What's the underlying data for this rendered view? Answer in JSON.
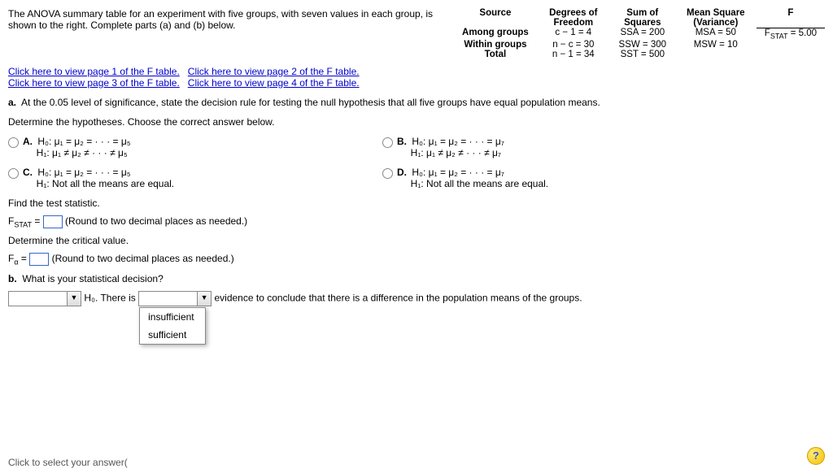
{
  "intro": "The ANOVA summary table for an experiment with five groups, with seven values in each group, is shown to the right. Complete parts (a) and (b) below.",
  "anova": {
    "headers": {
      "source": "Source",
      "df": "Degrees of Freedom",
      "ss": "Sum of Squares",
      "ms": "Mean Square (Variance)",
      "f": "F"
    },
    "rows": {
      "among": {
        "label": "Among groups",
        "df": "c − 1 = 4",
        "ss": "SSA = 200",
        "ms": "MSA = 50",
        "f_label": "F",
        "f_sub": "STAT",
        "f_val": " = 5.00"
      },
      "within": {
        "label": "Within groups",
        "df": "n − c = 30",
        "ss": "SSW = 300",
        "ms": "MSW = 10"
      },
      "total": {
        "label": "Total",
        "df": "n − 1 = 34",
        "ss": "SST = 500"
      }
    }
  },
  "links": {
    "p1": "Click here to view page 1 of the F table.",
    "p2": "Click here to view page 2 of the F table.",
    "p3": "Click here to view page 3 of the F table.",
    "p4": "Click here to view page 4 of the F table."
  },
  "qa": {
    "prompt_label": "a.",
    "prompt": "At the 0.05 level of significance, state the decision rule for testing the null hypothesis that all five groups have equal population means.",
    "determine": "Determine the hypotheses. Choose the correct answer below."
  },
  "options": {
    "a": {
      "lbl": "A.",
      "l1": "H₀: μ₁ = μ₂ = · · · = μ₅",
      "l2": "H₁: μ₁ ≠ μ₂ ≠ · · · ≠ μ₅"
    },
    "b": {
      "lbl": "B.",
      "l1": "H₀: μ₁ = μ₂ = · · · = μ₇",
      "l2": "H₁: μ₁ ≠ μ₂ ≠ · · · ≠ μ₇"
    },
    "c": {
      "lbl": "C.",
      "l1": "H₀: μ₁ = μ₂ = · · · = μ₅",
      "l2": "H₁: Not all the means are equal."
    },
    "d": {
      "lbl": "D.",
      "l1": "H₀: μ₁ = μ₂ = · · · = μ₇",
      "l2": "H₁: Not all the means are equal."
    }
  },
  "find_stat": "Find the test statistic.",
  "fstat": {
    "prefix": "F",
    "sub": "STAT",
    "eq": " = ",
    "hint": "(Round to two decimal places as needed.)"
  },
  "crit": {
    "determine": "Determine the critical value.",
    "prefix": "F",
    "sub": "α",
    "eq": " = ",
    "hint": "(Round to two decimal places as needed.)"
  },
  "qb": {
    "label": "b.",
    "prompt": "What is your statistical decision?",
    "h0": "H₀.",
    "there_is": " There is ",
    "conclusion": " evidence to conclude that there is a difference in the population means of the groups."
  },
  "dropdown": {
    "opt1": "insufficient",
    "opt2": "sufficient"
  },
  "footer": "Click to select your answer(",
  "help": "?"
}
